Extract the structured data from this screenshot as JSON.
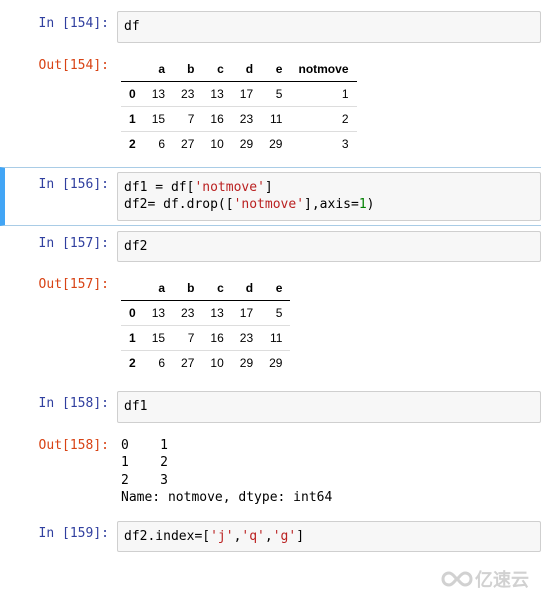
{
  "cells": {
    "c154": {
      "in_label": "In  [154]:",
      "out_label": "Out[154]:",
      "code": "df",
      "table": {
        "columns": [
          "a",
          "b",
          "c",
          "d",
          "e",
          "notmove"
        ],
        "index": [
          "0",
          "1",
          "2"
        ],
        "rows": [
          [
            "13",
            "23",
            "13",
            "17",
            "5",
            "1"
          ],
          [
            "15",
            "7",
            "16",
            "23",
            "11",
            "2"
          ],
          [
            "6",
            "27",
            "10",
            "29",
            "29",
            "3"
          ]
        ]
      }
    },
    "c156": {
      "in_label": "In  [156]:",
      "code_line1_pre": "df1 = df[",
      "code_line1_str": "'notmove'",
      "code_line1_post": "]",
      "code_line2_pre": "df2= df.drop([",
      "code_line2_str": "'notmove'",
      "code_line2_mid": "],axis=",
      "code_line2_num": "1",
      "code_line2_post": ")"
    },
    "c157": {
      "in_label": "In  [157]:",
      "out_label": "Out[157]:",
      "code": "df2",
      "table": {
        "columns": [
          "a",
          "b",
          "c",
          "d",
          "e"
        ],
        "index": [
          "0",
          "1",
          "2"
        ],
        "rows": [
          [
            "13",
            "23",
            "13",
            "17",
            "5"
          ],
          [
            "15",
            "7",
            "16",
            "23",
            "11"
          ],
          [
            "6",
            "27",
            "10",
            "29",
            "29"
          ]
        ]
      }
    },
    "c158": {
      "in_label": "In  [158]:",
      "out_label": "Out[158]:",
      "code": "df1",
      "text_output": "0    1\n1    2\n2    3\nName: notmove, dtype: int64"
    },
    "c159": {
      "in_label": "In  [159]:",
      "code_pre": "df2.index=[",
      "code_s1": "'j'",
      "code_c1": ",",
      "code_s2": "'q'",
      "code_c2": ",",
      "code_s3": "'g'",
      "code_post": "]"
    }
  },
  "watermark": "亿速云"
}
